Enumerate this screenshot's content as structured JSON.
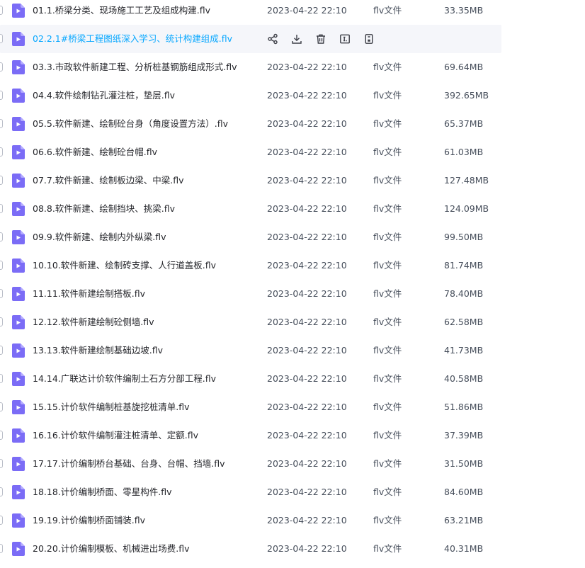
{
  "colors": {
    "accent": "#06a7ff",
    "icon_purple": "#7b6cf6",
    "text_primary": "#25262b",
    "text_secondary": "#454d5a",
    "hover_bg": "#f5f6fa"
  },
  "hover_row_index": 1,
  "hover_actions": [
    "share-icon",
    "download-icon",
    "delete-icon",
    "rename-icon",
    "more-icon"
  ],
  "files": [
    {
      "name": "01.1.桥梁分类、现场施工工艺及组成构建.flv",
      "date": "2023-04-22 22:10",
      "type": "flv文件",
      "size": "33.35MB"
    },
    {
      "name": "02.2.1#桥梁工程图纸深入学习、统计构建组成.flv",
      "date": "",
      "type": "",
      "size": ""
    },
    {
      "name": "03.3.市政软件新建工程、分析桩基钢筋组成形式.flv",
      "date": "2023-04-22 22:10",
      "type": "flv文件",
      "size": "69.64MB"
    },
    {
      "name": "04.4.软件绘制钻孔灌注桩，垫层.flv",
      "date": "2023-04-22 22:10",
      "type": "flv文件",
      "size": "392.65MB"
    },
    {
      "name": "05.5.软件新建、绘制砼台身（角度设置方法）.flv",
      "date": "2023-04-22 22:10",
      "type": "flv文件",
      "size": "65.37MB"
    },
    {
      "name": "06.6.软件新建、绘制砼台帽.flv",
      "date": "2023-04-22 22:10",
      "type": "flv文件",
      "size": "61.03MB"
    },
    {
      "name": "07.7.软件新建、绘制板边梁、中梁.flv",
      "date": "2023-04-22 22:10",
      "type": "flv文件",
      "size": "127.48MB"
    },
    {
      "name": "08.8.软件新建、绘制挡块、挑梁.flv",
      "date": "2023-04-22 22:10",
      "type": "flv文件",
      "size": "124.09MB"
    },
    {
      "name": "09.9.软件新建、绘制内外纵梁.flv",
      "date": "2023-04-22 22:10",
      "type": "flv文件",
      "size": "99.50MB"
    },
    {
      "name": "10.10.软件新建、绘制砖支撑、人行道盖板.flv",
      "date": "2023-04-22 22:10",
      "type": "flv文件",
      "size": "81.74MB"
    },
    {
      "name": "11.11.软件新建绘制搭板.flv",
      "date": "2023-04-22 22:10",
      "type": "flv文件",
      "size": "78.40MB"
    },
    {
      "name": "12.12.软件新建绘制砼侧墙.flv",
      "date": "2023-04-22 22:10",
      "type": "flv文件",
      "size": "62.58MB"
    },
    {
      "name": "13.13.软件新建绘制基础边坡.flv",
      "date": "2023-04-22 22:10",
      "type": "flv文件",
      "size": "41.73MB"
    },
    {
      "name": "14.14.广联达计价软件编制土石方分部工程.flv",
      "date": "2023-04-22 22:10",
      "type": "flv文件",
      "size": "40.58MB"
    },
    {
      "name": "15.15.计价软件编制桩基旋挖桩清单.flv",
      "date": "2023-04-22 22:10",
      "type": "flv文件",
      "size": "51.86MB"
    },
    {
      "name": "16.16.计价软件编制灌注桩清单、定额.flv",
      "date": "2023-04-22 22:10",
      "type": "flv文件",
      "size": "37.39MB"
    },
    {
      "name": "17.17.计价编制桥台基础、台身、台帽、挡墙.flv",
      "date": "2023-04-22 22:10",
      "type": "flv文件",
      "size": "31.50MB"
    },
    {
      "name": "18.18.计价编制桥面、零星构件.flv",
      "date": "2023-04-22 22:10",
      "type": "flv文件",
      "size": "84.60MB"
    },
    {
      "name": "19.19.计价编制桥面铺装.flv",
      "date": "2023-04-22 22:10",
      "type": "flv文件",
      "size": "63.21MB"
    },
    {
      "name": "20.20.计价编制模板、机械进出场费.flv",
      "date": "2023-04-22 22:10",
      "type": "flv文件",
      "size": "40.31MB"
    }
  ]
}
